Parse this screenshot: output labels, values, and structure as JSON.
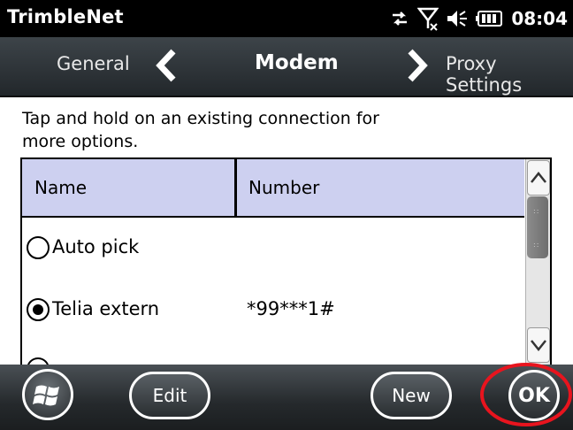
{
  "app": {
    "title": "TrimbleNet",
    "clock": "08:04"
  },
  "status_icons": [
    "data-sync-icon",
    "no-signal-icon",
    "speaker-icon",
    "battery-icon"
  ],
  "nav": {
    "prev_label": "General",
    "current_label": "Modem",
    "next_label": "Proxy Settings"
  },
  "instructions": "Tap and hold on an existing connection for more options.",
  "table": {
    "columns": [
      "Name",
      "Number"
    ],
    "rows": [
      {
        "name": "Auto pick",
        "number": "",
        "selected": false
      },
      {
        "name": "Telia extern",
        "number": "*99***1#",
        "selected": true
      }
    ]
  },
  "softkeys": {
    "edit": "Edit",
    "new": "New",
    "ok": "OK"
  },
  "colors": {
    "header_background": "#cdd0f0",
    "highlight": "#e8141e"
  }
}
